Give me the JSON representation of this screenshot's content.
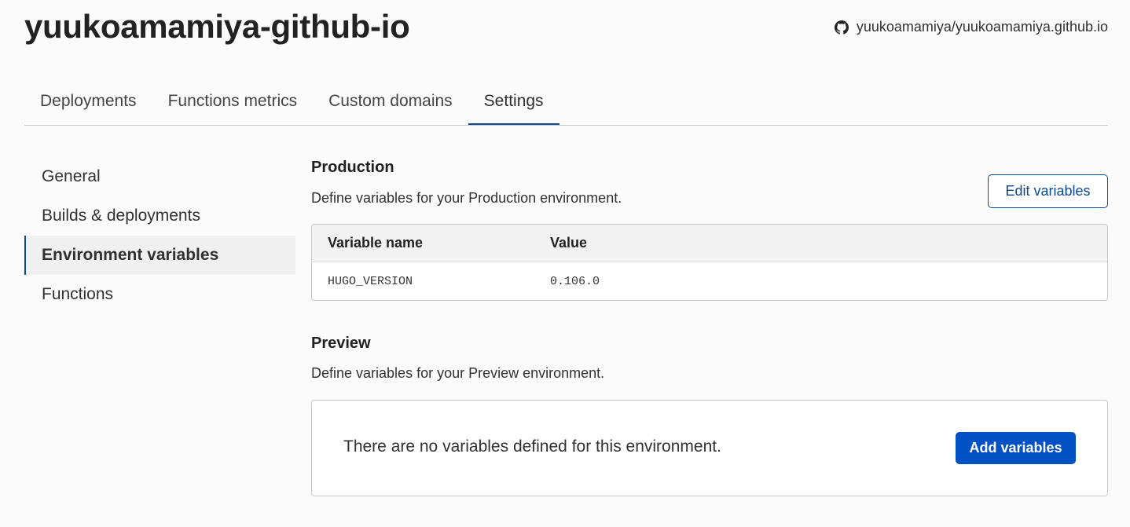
{
  "header": {
    "title": "yuukoamamiya-github-io",
    "repo_icon": "github-icon",
    "repo_label": "yuukoamamiya/yuukoamamiya.github.io"
  },
  "tabs": [
    {
      "label": "Deployments",
      "active": false
    },
    {
      "label": "Functions metrics",
      "active": false
    },
    {
      "label": "Custom domains",
      "active": false
    },
    {
      "label": "Settings",
      "active": true
    }
  ],
  "sidenav": {
    "items": [
      {
        "label": "General",
        "active": false
      },
      {
        "label": "Builds & deployments",
        "active": false
      },
      {
        "label": "Environment variables",
        "active": true
      },
      {
        "label": "Functions",
        "active": false
      }
    ]
  },
  "production": {
    "title": "Production",
    "description": "Define variables for your Production environment.",
    "edit_button": "Edit variables",
    "table": {
      "headers": [
        "Variable name",
        "Value"
      ],
      "rows": [
        {
          "name": "HUGO_VERSION",
          "value": "0.106.0"
        }
      ]
    }
  },
  "preview": {
    "title": "Preview",
    "description": "Define variables for your Preview environment.",
    "empty_message": "There are no variables defined for this environment.",
    "add_button": "Add variables"
  },
  "colors": {
    "accent": "#0051c3",
    "accent_dark": "#0b4a8f",
    "border": "#c8c8c8"
  }
}
